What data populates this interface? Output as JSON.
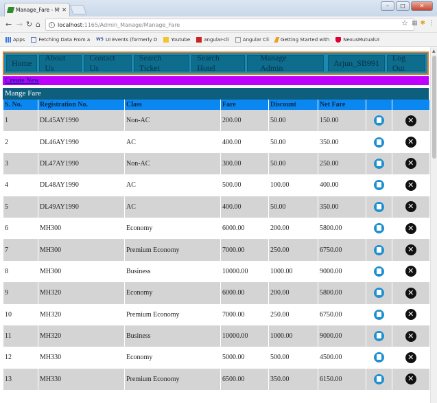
{
  "browser": {
    "tab_title": "Manage_Fare - My First A",
    "tab_close": "✕",
    "url_host": "localhost",
    "url_path": ":1165/Admin_Manage/Manage_Fare",
    "window_buttons": {
      "minimize": "–",
      "maximize": "□",
      "close": "✕"
    },
    "bookmarks": [
      {
        "label": "Apps",
        "icon": "apps-grid-icon",
        "color": "#3c78d8"
      },
      {
        "label": "Fetching Data From a",
        "icon": "page-icon",
        "color": "#5577aa"
      },
      {
        "label": "UI Events (formerly D",
        "icon": "ws-icon",
        "color": "#335599"
      },
      {
        "label": "Youtube",
        "icon": "folder-icon",
        "color": "#f4c430"
      },
      {
        "label": "angular-cli",
        "icon": "red-square-icon",
        "color": "#cc2222"
      },
      {
        "label": "Angular Cli",
        "icon": "blank-page-icon",
        "color": "#999999"
      },
      {
        "label": "Getting Started with",
        "icon": "lightning-icon",
        "color": "#f0a020"
      },
      {
        "label": "NexusMutualUI",
        "icon": "angular-shield-icon",
        "color": "#dd0031"
      }
    ]
  },
  "nav": {
    "items": [
      "Home",
      "About Us",
      "Contact Us",
      "Search Ticket",
      "Search Hotel",
      "Manage Admin"
    ],
    "user": "Arjun_SB991",
    "logout": "Log Out"
  },
  "create_new": "Create New",
  "table": {
    "title": "Mange Fare",
    "headers": [
      "S. No.",
      "Registration No.",
      "Class",
      "Fare",
      "Discount",
      "Net Fare",
      "",
      ""
    ],
    "rows": [
      [
        "1",
        "DL45AY1990",
        "Non-AC",
        "200.00",
        "50.00",
        "150.00"
      ],
      [
        "2",
        "DL46AY1990",
        "AC",
        "400.00",
        "50.00",
        "350.00"
      ],
      [
        "3",
        "DL47AY1990",
        "Non-AC",
        "300.00",
        "50.00",
        "250.00"
      ],
      [
        "4",
        "DL48AY1990",
        "AC",
        "500.00",
        "100.00",
        "400.00"
      ],
      [
        "5",
        "DL49AY1990",
        "AC",
        "400.00",
        "50.00",
        "350.00"
      ],
      [
        "6",
        "MH300",
        "Economy",
        "6000.00",
        "200.00",
        "5800.00"
      ],
      [
        "7",
        "MH300",
        "Premium Economy",
        "7000.00",
        "250.00",
        "6750.00"
      ],
      [
        "8",
        "MH300",
        "Business",
        "10000.00",
        "1000.00",
        "9000.00"
      ],
      [
        "9",
        "MH320",
        "Economy",
        "6000.00",
        "200.00",
        "5800.00"
      ],
      [
        "10",
        "MH320",
        "Premium Economy",
        "7000.00",
        "250.00",
        "6750.00"
      ],
      [
        "11",
        "MH320",
        "Business",
        "10000.00",
        "1000.00",
        "9000.00"
      ],
      [
        "12",
        "MH330",
        "Economy",
        "5000.00",
        "500.00",
        "4500.00"
      ],
      [
        "13",
        "MH330",
        "Premium Economy",
        "6500.00",
        "350.00",
        "6150.00"
      ]
    ]
  },
  "colors": {
    "nav_bg": "#1b8ab0",
    "nav_border": "#e27d28",
    "create_bar": "#c000ff",
    "table_title_bg": "#0d5f7d",
    "header_bg": "#0a87f0",
    "row_alt": "#d4d4d4"
  }
}
